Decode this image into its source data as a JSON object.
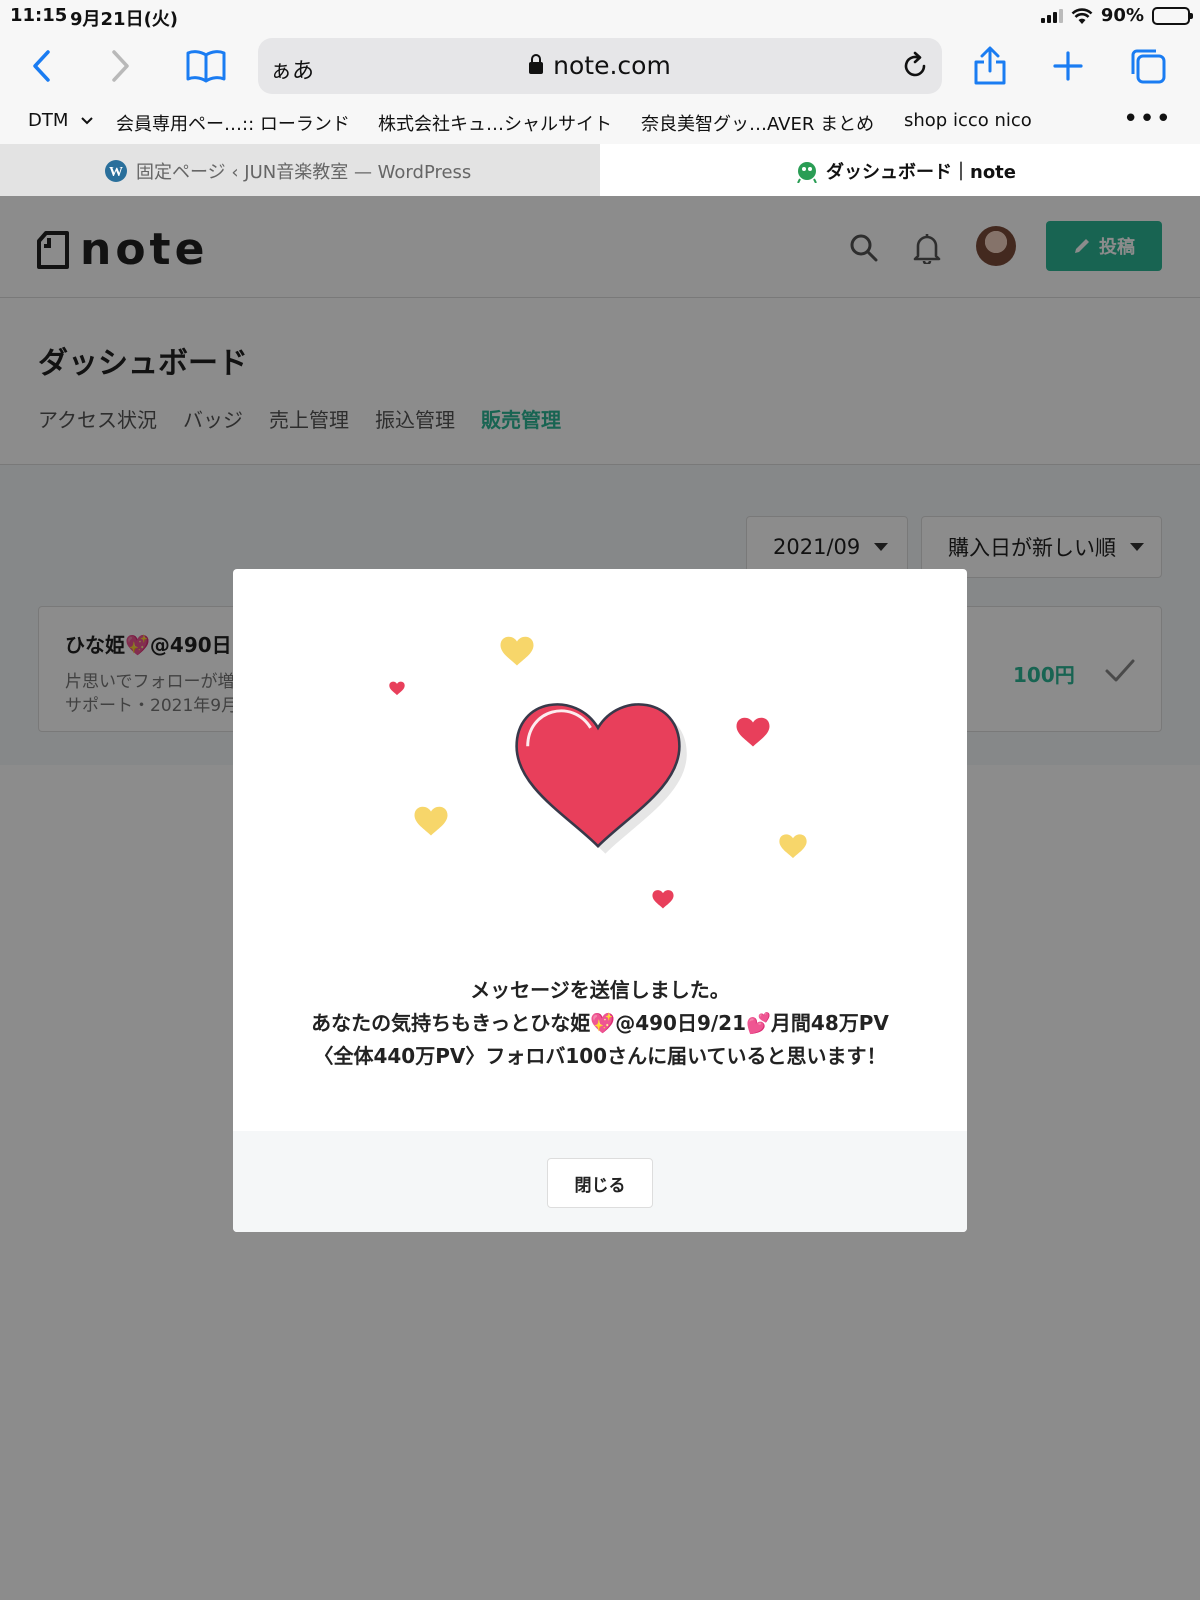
{
  "status_bar": {
    "time": "11:15",
    "date": "9月21日(火)",
    "battery": "90%",
    "battery_level": 0.9
  },
  "browser": {
    "text_size_label": "ぁあ",
    "domain": "note.com",
    "favorites": [
      {
        "label": "DTM"
      },
      {
        "label": "会員専用ペー…:: ローランド"
      },
      {
        "label": "株式会社キュ…シャルサイト"
      },
      {
        "label": "奈良美智グッ…AVER まとめ"
      },
      {
        "label": "shop icco nico"
      }
    ],
    "tabs": [
      {
        "label": "固定ページ ‹ JUN音楽教室 — WordPress",
        "active": false
      },
      {
        "label": "ダッシュボード｜note",
        "active": true
      }
    ]
  },
  "header": {
    "logo_text": "note",
    "post_button_label": "投稿",
    "brand_color": "#2cb696"
  },
  "dashboard": {
    "title": "ダッシュボード",
    "tabs": [
      {
        "label": "アクセス状況",
        "active": false
      },
      {
        "label": "バッジ",
        "active": false
      },
      {
        "label": "売上管理",
        "active": false
      },
      {
        "label": "振込管理",
        "active": false
      },
      {
        "label": "販売管理",
        "active": true
      }
    ],
    "filters": {
      "month": "2021/09",
      "sort": "購入日が新しい順"
    },
    "sales": [
      {
        "title": "ひな姫💖@490日",
        "description": "片思いでフォローが増",
        "meta": "サポート・2021年9月",
        "price": "100円"
      }
    ]
  },
  "modal": {
    "message_lines": [
      "メッセージを送信しました。",
      "あなたの気持ちもきっとひな姫💖@490日9/21💕月間48万PV",
      "〈全体440万PV〉フォロバ100さんに届いていると思います！"
    ],
    "close_label": "閉じる",
    "heart_color": "#e83f5b",
    "small_heart_yellow": "#f7d66a"
  }
}
